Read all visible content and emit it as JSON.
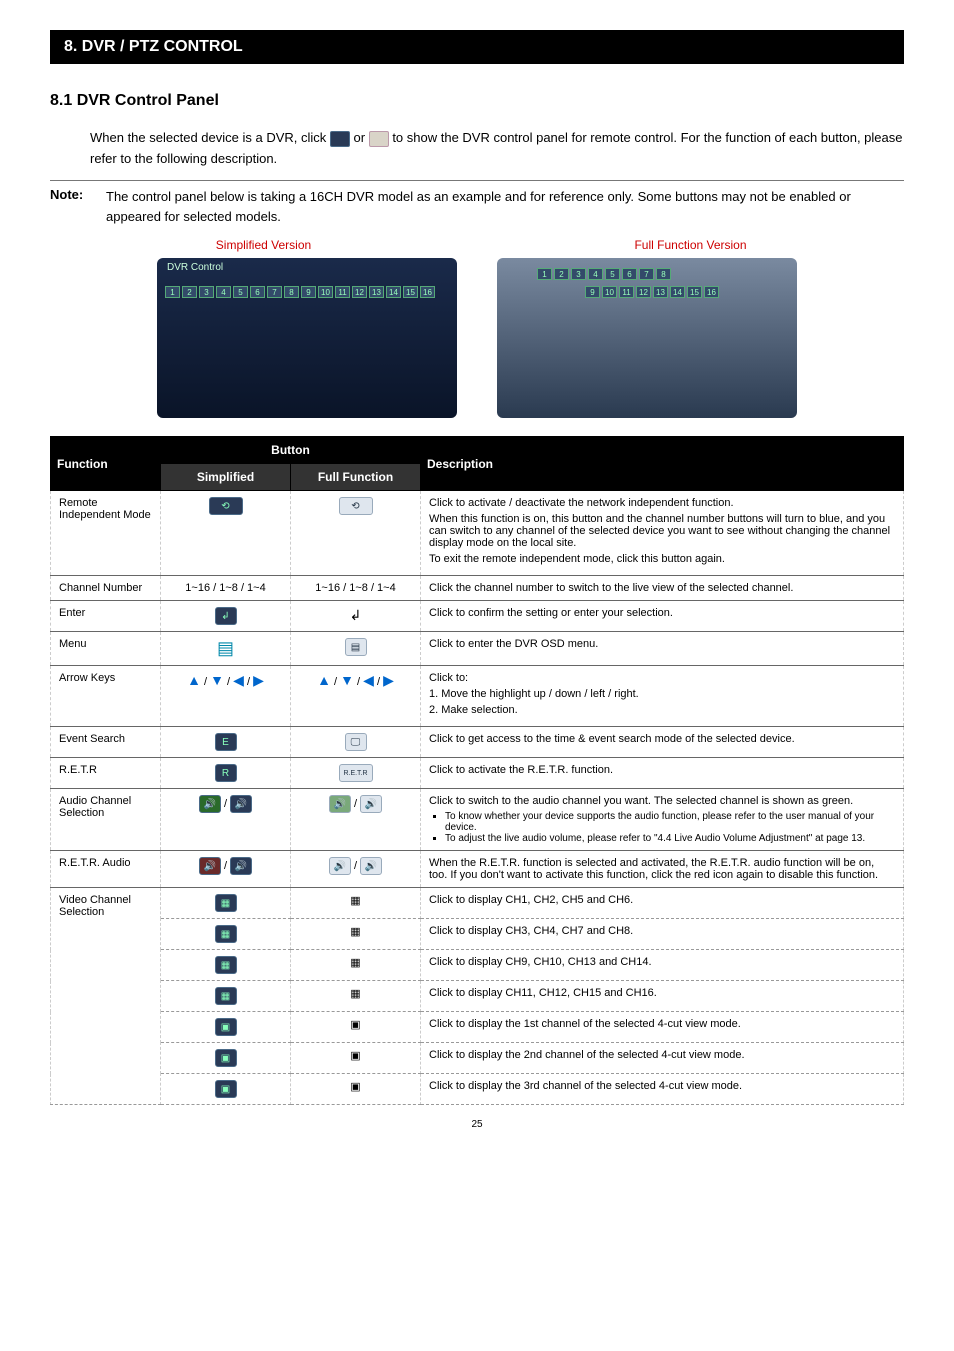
{
  "section_title": "8. DVR / PTZ CONTROL",
  "subheading": "8.1 DVR Control Panel",
  "intro_before_icons": "When the selected device is a DVR, click ",
  "intro_between_icons": " or ",
  "intro_after_icons": " to show the DVR control panel for remote control. For the function of each button, please refer to the following description.",
  "note_label": "Note:",
  "note_text": "The control panel below is taking a 16CH DVR model as an example and for reference only. Some buttons may not be enabled or appeared for selected models.",
  "simplified_label": "Simplified Version",
  "full_label": "Full Function Version",
  "panel_window_title": "DVR Control",
  "table": {
    "headers": {
      "function": "Function",
      "button": "Button",
      "simplified": "Simplified",
      "full_function": "Full Function",
      "description": "Description"
    }
  },
  "rows": {
    "remote": {
      "function": "Remote Independent Mode",
      "desc_line1": "Click to activate / deactivate the network independent function.",
      "desc_line2": "When this function is on, this button and the channel number buttons will turn to blue, and you can switch to any channel of the selected device you want to see without changing the channel display mode on the local site.",
      "desc_line3": "To exit the remote independent mode, click this button again."
    },
    "channel": {
      "function": "Channel Number",
      "values": "1~16 / 1~8 / 1~4",
      "desc": "Click the channel number to switch to the live view of the selected channel."
    },
    "enter": {
      "function": "Enter",
      "glyph": "↲",
      "desc": "Click to confirm the setting or enter your selection."
    },
    "menu": {
      "function": "Menu",
      "desc": "Click to enter the DVR OSD menu."
    },
    "arrows": {
      "function": "Arrow Keys",
      "desc1": "Click to:",
      "desc2": "1. Move the highlight up / down / left / right.",
      "desc3": "2. Make selection."
    },
    "event": {
      "function": "Event Search",
      "desc": "Click to get access to the time & event search mode of the selected device."
    },
    "retr": {
      "function": "R.E.T.R",
      "desc": "Click to activate the R.E.T.R. function."
    },
    "audio_ch": {
      "function": "Audio Channel Selection",
      "desc_line1": "Click to switch to the audio channel you want. The selected channel is shown as green.",
      "bullet1": "To know whether your device supports the audio function, please refer to the user manual of your device.",
      "bullet2": "To adjust the live audio volume, please refer to \"4.4 Live Audio Volume Adjustment\" at page 13."
    },
    "retr_audio": {
      "function": "R.E.T.R. Audio",
      "desc": "When the R.E.T.R. function is selected and activated, the R.E.T.R. audio function will be on, too. If you don't want to activate this function, click the red icon again to disable this function."
    },
    "video": {
      "function": "Video Channel Selection",
      "d1": "Click to display CH1, CH2, CH5 and CH6.",
      "d2": "Click to display CH3, CH4, CH7 and CH8.",
      "d3": "Click to display CH9, CH10, CH13 and CH14.",
      "d4": "Click to display CH11, CH12, CH15 and CH16.",
      "d5": "Click to display the 1st channel of the selected 4-cut view mode.",
      "d6": "Click to display the 2nd channel of the selected 4-cut view mode.",
      "d7": "Click to display the 3rd channel of the selected 4-cut view mode."
    }
  },
  "page_number": "25"
}
